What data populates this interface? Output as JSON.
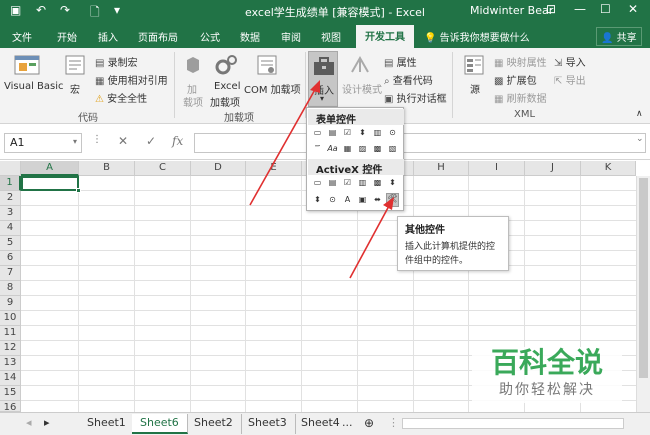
{
  "titlebar": {
    "title": "excel学生成绩单  [兼容模式]  -  Excel",
    "user": "Midwinter Bear",
    "qa": {
      "save": "▣",
      "undo": "↶",
      "redo": "↷",
      "new": "🗋",
      "more": "▾"
    },
    "win": {
      "ribbon_opts": "⊡",
      "min": "—",
      "max": "☐",
      "close": "✕"
    }
  },
  "tabs": {
    "items": [
      "文件",
      "开始",
      "插入",
      "页面布局",
      "公式",
      "数据",
      "审阅",
      "视图"
    ],
    "active": "开发工具",
    "tellme": "告诉我你想要做什么",
    "share": "共享"
  },
  "ribbon": {
    "code": {
      "visual_basic": "Visual Basic",
      "macro": "宏",
      "record": "录制宏",
      "relative": "使用相对引用",
      "security": "安全全性",
      "group_label": "代码"
    },
    "addins": {
      "addin_l1": "加",
      "addin_l2": "载项",
      "excel_l1": "Excel",
      "excel_l2": "加载项",
      "com": "COM 加载项",
      "group_label": "加载项"
    },
    "controls": {
      "insert": "插入",
      "design_mode": "设计模式",
      "properties": "属性",
      "view_code": "查看代码",
      "run_dialog": "执行对话框"
    },
    "xml": {
      "source": "源",
      "map_props": "映射属性",
      "expansion": "扩展包",
      "refresh": "刷新数据",
      "import": "导入",
      "export": "导出",
      "group_label": "XML"
    }
  },
  "formula_bar": {
    "cell_ref": "A1",
    "cancel": "✕",
    "enter": "✓",
    "fx": "fx",
    "value": ""
  },
  "grid": {
    "columns": [
      "A",
      "B",
      "C",
      "D",
      "E",
      "F",
      "G",
      "H",
      "I",
      "J",
      "K"
    ],
    "rows": [
      "1",
      "2",
      "3",
      "4",
      "5",
      "6",
      "7",
      "8",
      "9",
      "10",
      "11",
      "12",
      "13",
      "14",
      "15",
      "16"
    ]
  },
  "dropdown": {
    "form_header": "表单控件",
    "activex_header": "ActiveX 控件",
    "form_row1": [
      "▭",
      "▤",
      "☑",
      "⬍",
      "▥",
      "⊙"
    ],
    "form_row2": [
      "⁗",
      "Aa",
      "▦",
      "▨",
      "▩",
      "▧"
    ],
    "ax_row1": [
      "▭",
      "▤",
      "☑",
      "▥",
      "▩",
      "⬍"
    ],
    "ax_row2": [
      "⬍",
      "⊙",
      "A",
      "▣",
      "⬌",
      "🛠"
    ]
  },
  "tooltip": {
    "title": "其他控件",
    "line1": "插入此计算机提供的控",
    "line2": "件组中的控件。"
  },
  "sheets": {
    "tabs": [
      "Sheet1",
      "Sheet6",
      "Sheet2",
      "Sheet3",
      "Sheet4"
    ],
    "active_index": 1,
    "more": "...",
    "add": "⊕",
    "nav_prev": "◂",
    "nav_next": "▸"
  },
  "watermark": {
    "line1": "百科全说",
    "line2": "助你轻松解决"
  },
  "colors": {
    "excel_green": "#217346",
    "annotation_red": "#e03030",
    "watermark_green": "#3aa95a"
  }
}
